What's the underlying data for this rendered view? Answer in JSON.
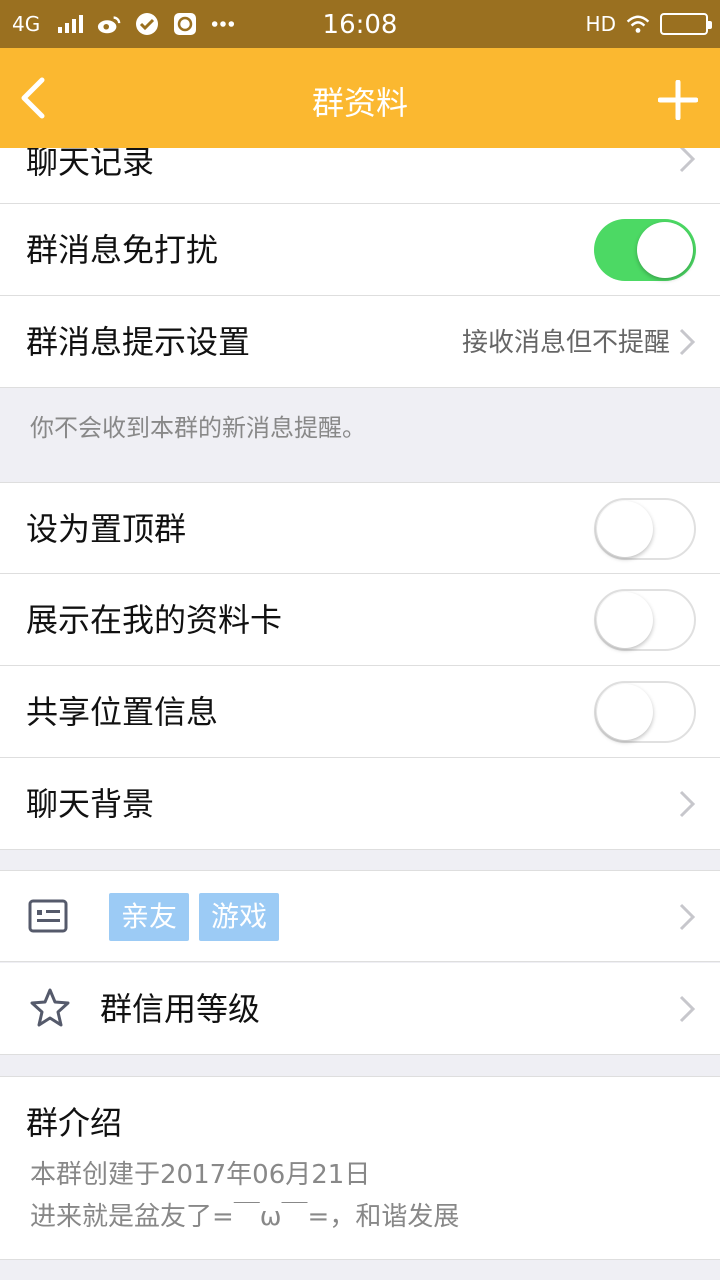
{
  "status_bar": {
    "network": "4G",
    "time": "16:08",
    "hd": "HD"
  },
  "nav": {
    "title": "群资料"
  },
  "rows": {
    "chat_history": "聊天记录",
    "mute": "群消息免打扰",
    "notify_setting": "群消息提示设置",
    "notify_setting_value": "接收消息但不提醒",
    "notify_note": "你不会收到本群的新消息提醒。",
    "pin_group": "设为置顶群",
    "show_on_profile": "展示在我的资料卡",
    "share_location": "共享位置信息",
    "chat_background": "聊天背景"
  },
  "tags": [
    "亲友",
    "游戏"
  ],
  "credit": {
    "label": "群信用等级"
  },
  "intro": {
    "title": "群介绍",
    "line1": "本群创建于2017年06月21日",
    "line2": "进来就是盆友了=￣ω￣=，和谐发展"
  },
  "toggles": {
    "mute": true,
    "pin_group": false,
    "show_on_profile": false,
    "share_location": false
  },
  "colors": {
    "status_bar": "#9a7020",
    "nav_bar": "#fbb830",
    "toggle_on": "#4cd964",
    "tag_bg": "#9ccbf5",
    "page_bg": "#efeff4"
  }
}
